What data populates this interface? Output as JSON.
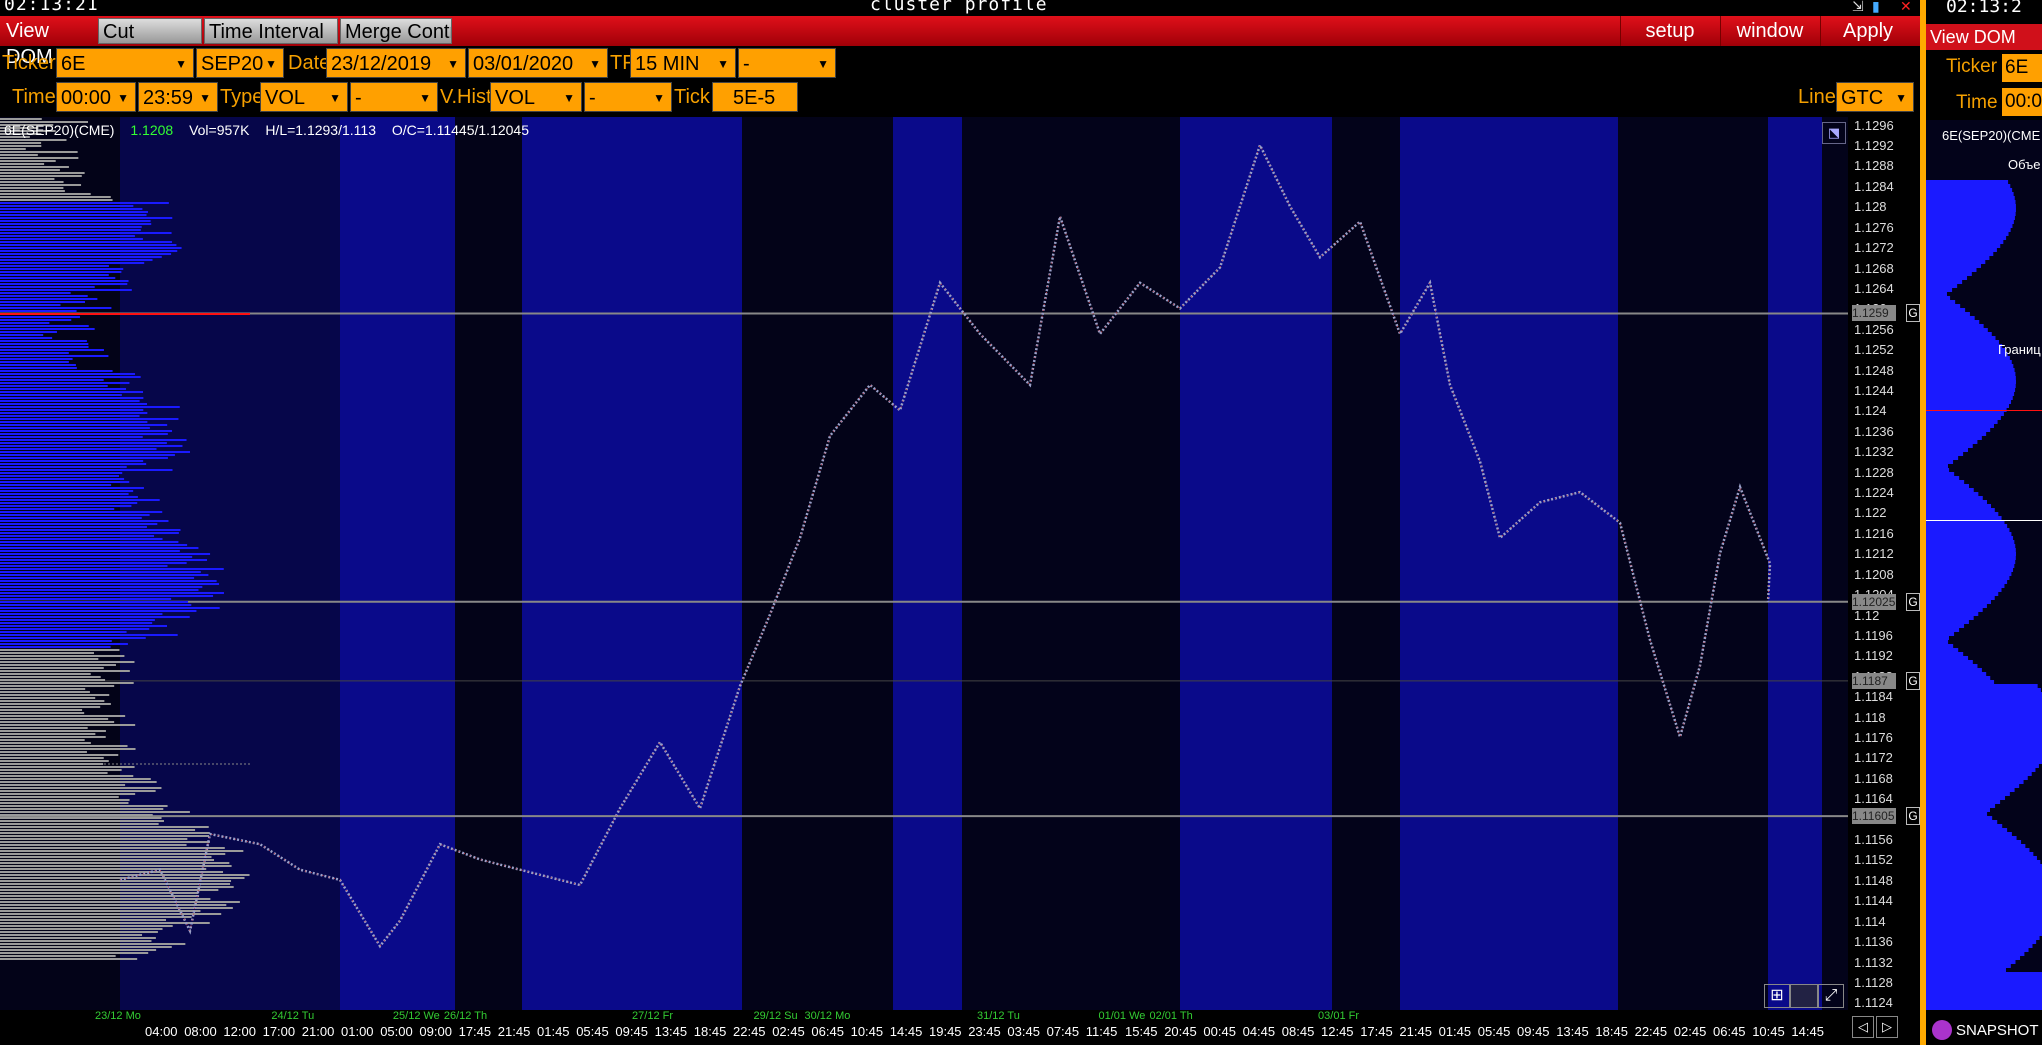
{
  "window": {
    "clock": "02:13:21",
    "title": "cluster profile",
    "controls": [
      "⇲",
      "▮",
      "✕"
    ]
  },
  "menu": {
    "view_dom": "View DOM",
    "cut_breaks": "Cut Breaks",
    "time_interval": "Time Interval",
    "merge_contr": "Merge Contr",
    "setup": "setup",
    "window": "window",
    "apply": "Apply"
  },
  "toolbar1": {
    "ticker_label": "Ticker",
    "ticker": "6E",
    "contract": "SEP20",
    "date_label": "Date",
    "date_from": "23/12/2019",
    "date_to": "03/01/2020",
    "tf_label": "TF",
    "tf": "15 MIN",
    "tf_extra": "-"
  },
  "toolbar2": {
    "time_label": "Time",
    "time_from": "00:00",
    "time_to": "23:59",
    "type_label": "Type",
    "type": "VOL",
    "type_extra": "-",
    "vhist_label": "V.Hist",
    "vhist": "VOL",
    "vhist_extra": "-",
    "tick_label": "Tick",
    "tick": "5E-5",
    "line_label": "Line",
    "line": "GTC"
  },
  "info": {
    "symbol": "6E(SEP20)(CME)",
    "price": "1.1208",
    "vol": "Vol=957K",
    "hl": "H/L=1.1293/1.113",
    "oc": "O/C=1.11445/1.12045"
  },
  "colors": {
    "menu_red": "#d0101a",
    "field_orange": "#ffa000",
    "day_blue": "#0a0a8a",
    "profile_blue": "#1a1aff",
    "profile_gray": "#9a9a9a"
  },
  "price_axis": {
    "ticks": [
      "1.1296",
      "1.1292",
      "1.1288",
      "1.1284",
      "1.128",
      "1.1276",
      "1.1272",
      "1.1268",
      "1.1264",
      "1.126",
      "1.1256",
      "1.1252",
      "1.1248",
      "1.1244",
      "1.124",
      "1.1236",
      "1.1232",
      "1.1228",
      "1.1224",
      "1.122",
      "1.1216",
      "1.1212",
      "1.1208",
      "1.1204",
      "1.12",
      "1.1196",
      "1.1192",
      "1.1188",
      "1.1184",
      "1.118",
      "1.1176",
      "1.1172",
      "1.1168",
      "1.1164",
      "1.116",
      "1.1156",
      "1.1152",
      "1.1148",
      "1.1144",
      "1.114",
      "1.1136",
      "1.1132",
      "1.1128",
      "1.1124"
    ],
    "levels": [
      {
        "label": "1.1259",
        "value": 1.1259,
        "mark": "G"
      },
      {
        "label": "1.12025",
        "value": 1.12025,
        "mark": "G"
      },
      {
        "label": "1.1187",
        "value": 1.1187,
        "mark": "G"
      },
      {
        "label": "1.11605",
        "value": 1.11605,
        "mark": "G"
      }
    ],
    "range": [
      1.11225,
      1.12975
    ]
  },
  "x_axis": {
    "times": [
      "04:00",
      "08:00",
      "12:00",
      "17:00",
      "21:00",
      "01:00",
      "05:00",
      "09:00",
      "17:45",
      "21:45",
      "01:45",
      "05:45",
      "09:45",
      "13:45",
      "18:45",
      "22:45",
      "02:45",
      "06:45",
      "10:45",
      "14:45",
      "19:45",
      "23:45",
      "03:45",
      "07:45",
      "11:45",
      "15:45",
      "20:45",
      "00:45",
      "04:45",
      "08:45",
      "12:45",
      "17:45",
      "21:45",
      "01:45",
      "05:45",
      "09:45",
      "13:45",
      "18:45",
      "22:45",
      "02:45",
      "06:45",
      "10:45",
      "14:45"
    ],
    "dates": [
      {
        "label": "23/12 Mo",
        "i": 0
      },
      {
        "label": "24/12 Tu",
        "i": 4.5
      },
      {
        "label": "25/12 We",
        "i": 7.6
      },
      {
        "label": "26/12 Th",
        "i": 8.9
      },
      {
        "label": "27/12 Fr",
        "i": 13.7
      },
      {
        "label": "29/12 Su",
        "i": 16.8
      },
      {
        "label": "30/12 Mo",
        "i": 18.1
      },
      {
        "label": "31/12 Tu",
        "i": 22.5
      },
      {
        "label": "01/01 We",
        "i": 25.6
      },
      {
        "label": "02/01 Th",
        "i": 26.9
      },
      {
        "label": "03/01 Fr",
        "i": 31.2
      }
    ]
  },
  "side_panel": {
    "clock": "02:13:2",
    "view_dom": "View DOM",
    "ticker_label": "Ticker",
    "ticker": "6E",
    "time_label": "Time",
    "time": "00:0",
    "symbol": "6E(SEP20)(CME",
    "note1": "Объе",
    "note2": "Границ",
    "snapshot": "SNAPSHOT"
  }
}
